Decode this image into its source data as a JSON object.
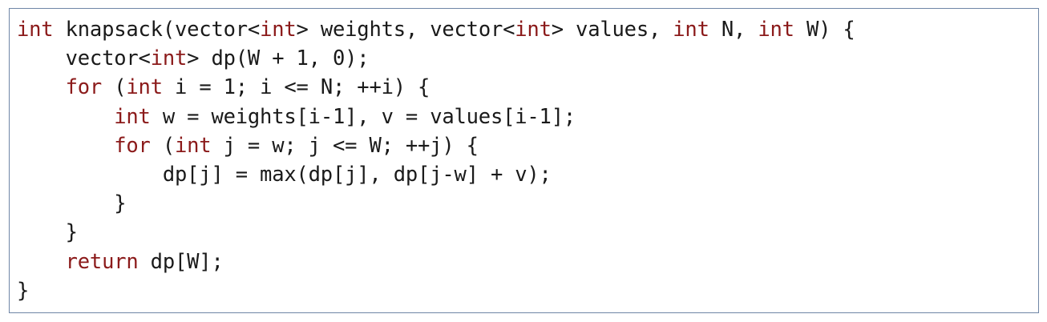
{
  "code": {
    "language": "C++",
    "keyword_color": "#8b1a1a",
    "text_color": "#1a1a1a",
    "border_color": "#6f86a6",
    "lines": [
      [
        {
          "t": "int",
          "k": true
        },
        {
          "t": " knapsack(vector<"
        },
        {
          "t": "int",
          "k": true
        },
        {
          "t": "> weights, vector<"
        },
        {
          "t": "int",
          "k": true
        },
        {
          "t": "> values, "
        },
        {
          "t": "int",
          "k": true
        },
        {
          "t": " N, "
        },
        {
          "t": "int",
          "k": true
        },
        {
          "t": " W) {"
        }
      ],
      [
        {
          "t": "    vector<"
        },
        {
          "t": "int",
          "k": true
        },
        {
          "t": "> dp(W + 1, 0);"
        }
      ],
      [
        {
          "t": "    "
        },
        {
          "t": "for",
          "k": true
        },
        {
          "t": " ("
        },
        {
          "t": "int",
          "k": true
        },
        {
          "t": " i = 1; i <= N; ++i) {"
        }
      ],
      [
        {
          "t": "        "
        },
        {
          "t": "int",
          "k": true
        },
        {
          "t": " w = weights[i-1], v = values[i-1];"
        }
      ],
      [
        {
          "t": "        "
        },
        {
          "t": "for",
          "k": true
        },
        {
          "t": " ("
        },
        {
          "t": "int",
          "k": true
        },
        {
          "t": " j = w; j <= W; ++j) {"
        }
      ],
      [
        {
          "t": "            dp[j] = max(dp[j], dp[j-w] + v);"
        }
      ],
      [
        {
          "t": "        }"
        }
      ],
      [
        {
          "t": "    }"
        }
      ],
      [
        {
          "t": "    "
        },
        {
          "t": "return",
          "k": true
        },
        {
          "t": " dp[W];"
        }
      ],
      [
        {
          "t": "}"
        }
      ]
    ]
  }
}
